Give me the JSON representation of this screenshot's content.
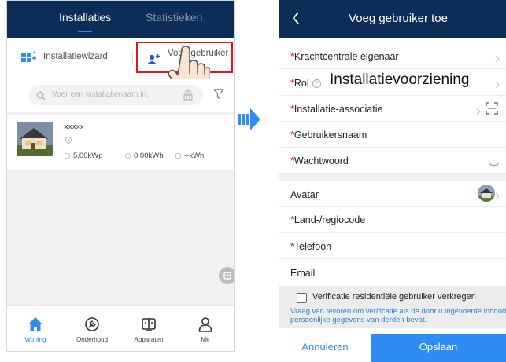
{
  "left": {
    "tabs": [
      {
        "label": "Installaties",
        "active": true
      },
      {
        "label": "Statistieken",
        "active": false
      }
    ],
    "wizard_label": "Installatiewizard",
    "add_user_label": "Voeg gebruiker",
    "search_placeholder": "Voer een installatienaam in.",
    "plant": {
      "name": "xxxxx",
      "power": "5,00kWp",
      "energy": "0,00kWh",
      "yield": "--kWh"
    },
    "nav": [
      {
        "label": "Woning",
        "icon": "home-icon",
        "active": true
      },
      {
        "label": "Onderhoud",
        "icon": "maintenance-icon",
        "active": false
      },
      {
        "label": "Apparaten",
        "icon": "devices-icon",
        "active": false
      },
      {
        "label": "Me",
        "icon": "person-icon",
        "active": false
      }
    ],
    "highlight_color": "#e0161f",
    "header_color": "#0b2d57",
    "accent_color": "#2e8cf2"
  },
  "right": {
    "title": "Voeg gebruiker toe",
    "fields": {
      "owner": "Krachtcentrale eigenaar",
      "role": "Rol",
      "role_value": "Installatievoorziening",
      "association": "Installatie-associatie",
      "username": "Gebruikersnaam",
      "password": "Wachtwoord",
      "avatar": "Avatar",
      "country_code": "Land-/regiocode",
      "phone": "Telefoon",
      "email": "Email"
    },
    "verify_label": "Verificatie residentiële gebruiker verkregen",
    "verify_note": "Vraag van tevoren om verificatie als de door u ingevoerde inhoud persoonlijke gegevens van derden bevat.",
    "cancel_label": "Annuleren",
    "save_label": "Opslaan"
  }
}
